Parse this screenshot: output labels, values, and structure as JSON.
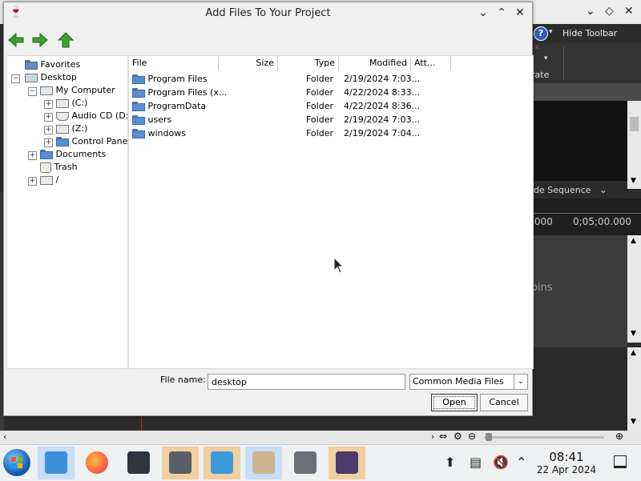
{
  "background_app": {
    "help_icon_label": "?",
    "hide_toolbar_label": "Hide Toolbar",
    "partial_tool_text": "rate",
    "sequence_label": "ide Sequence",
    "ruler_left": ".000",
    "ruler_right": "0;05;00.000",
    "track_text": "oins"
  },
  "dialog": {
    "title": "Add Files To Your Project",
    "tree": {
      "items": [
        {
          "label": "Favorites"
        },
        {
          "label": "Desktop"
        },
        {
          "label": "My Computer"
        },
        {
          "label": "(C:)"
        },
        {
          "label": "Audio CD (D:)"
        },
        {
          "label": "(Z:)"
        },
        {
          "label": "Control Panel"
        },
        {
          "label": "Documents"
        },
        {
          "label": "Trash"
        },
        {
          "label": "/"
        }
      ]
    },
    "file_list": {
      "headers": {
        "file": "File",
        "size": "Size",
        "type": "Type",
        "modified": "Modified",
        "attributes": "Att..."
      },
      "rows": [
        {
          "name": "Program Files",
          "type": "Folder",
          "modified": "2/19/2024 7:03..."
        },
        {
          "name": "Program Files (x...",
          "type": "Folder",
          "modified": "4/22/2024 8:33..."
        },
        {
          "name": "ProgramData",
          "type": "Folder",
          "modified": "4/22/2024 8:36..."
        },
        {
          "name": "users",
          "type": "Folder",
          "modified": "2/19/2024 7:03..."
        },
        {
          "name": "windows",
          "type": "Folder",
          "modified": "2/19/2024 7:04..."
        }
      ]
    },
    "file_name_label": "File name:",
    "file_name_value": "desktop",
    "file_type_selected": "Common Media Files",
    "open_label": "Open",
    "cancel_label": "Cancel"
  },
  "taskbar": {
    "time": "08:41",
    "date": "22 Apr 2024"
  },
  "colors": {
    "nav_arrow_green": "#3aa12f",
    "folder_blue": "#5b8ed0",
    "taskbar_highlight": "#f0cfa0",
    "taskbar_active": "#c6def7"
  }
}
